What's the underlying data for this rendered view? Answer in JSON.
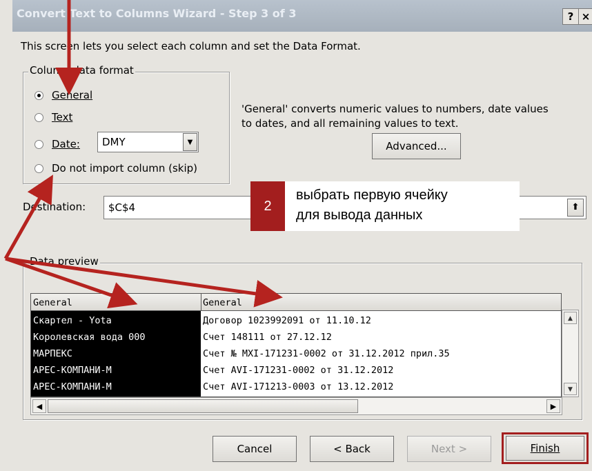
{
  "window": {
    "title": "Convert Text to Columns Wizard - Step 3 of 3",
    "help_glyph": "?",
    "close_glyph": "×"
  },
  "intro": "This screen lets you select each column and set the Data Format.",
  "format_group": {
    "label": "Column data format",
    "options": [
      {
        "label": "General",
        "selected": true
      },
      {
        "label": "Text",
        "selected": false
      },
      {
        "label": "Date:",
        "selected": false
      },
      {
        "label": "Do not import column (skip)",
        "selected": false
      }
    ],
    "date_value": "DMY"
  },
  "description": {
    "line1": "'General' converts numeric values to numbers, date values",
    "line2": "to dates, and all remaining values to text."
  },
  "advanced_label": "Advanced...",
  "destination": {
    "label": "Destination:",
    "value": "$C$4"
  },
  "annotation": {
    "number": "2",
    "line1": "выбрать первую ячейку",
    "line2": "для вывода данных",
    "arrow_color": "#b5231f",
    "badge_color": "#a31e1e"
  },
  "preview": {
    "label": "Data preview",
    "headers": [
      "General",
      "General"
    ],
    "rows": [
      [
        "Скартел - Yota",
        "Договор 1023992091 от 11.10.12"
      ],
      [
        "Королевская вода 000",
        "Счет 148111 от 27.12.12"
      ],
      [
        "МАРПЕКС",
        "Счет № MXI-171231-0002 от 31.12.2012 прил.35"
      ],
      [
        "АРЕС-КОМПАНИ-М",
        "Счет AVI-171231-0002 от 31.12.2012"
      ],
      [
        "АРЕС-КОМПАНИ-М",
        "Счет AVI-171213-0003 от 13.12.2012"
      ]
    ]
  },
  "buttons": {
    "cancel": "Cancel",
    "back": "< Back",
    "next": "Next >",
    "finish": "Finish"
  }
}
